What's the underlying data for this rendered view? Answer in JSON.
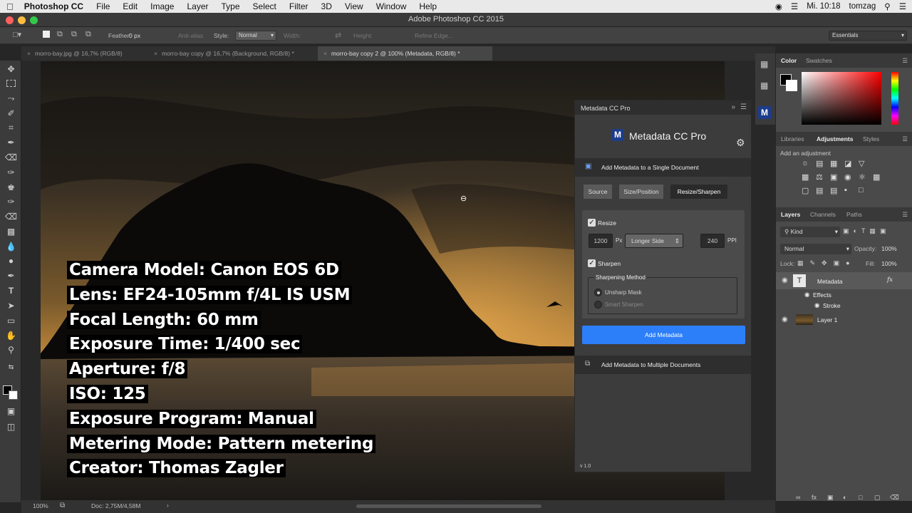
{
  "menubar": {
    "app": "Photoshop CC",
    "items": [
      "File",
      "Edit",
      "Image",
      "Layer",
      "Type",
      "Select",
      "Filter",
      "3D",
      "View",
      "Window",
      "Help"
    ],
    "time": "Mi. 10:18",
    "user": "tomzag"
  },
  "window": {
    "title": "Adobe Photoshop CC 2015"
  },
  "options": {
    "feather_label": "Feather:",
    "feather_value": "0 px",
    "antialias": "Anti-alias",
    "style_label": "Style:",
    "style_value": "Normal",
    "width_label": "Width:",
    "height_label": "Height:",
    "refine_edge": "Refine Edge...",
    "workspace": "Essentials"
  },
  "tabs": [
    "morro-bay.jpg @ 16,7% (RGB/8)",
    "morro-bay copy @ 16,7% (Background, RGB/8) *",
    "morro-bay copy 2 @ 100% (Metadata, RGB/8) *"
  ],
  "exif": [
    "Camera Model: Canon EOS 6D",
    "Lens: EF24-105mm f/4L IS USM",
    "Focal Length: 60 mm",
    "Exposure Time: 1/400 sec",
    "Aperture: f/8",
    "ISO: 125",
    "Exposure Program: Manual",
    "Metering Mode: Pattern metering",
    "Creator: Thomas Zagler"
  ],
  "status": {
    "zoom": "100%",
    "doc": "Doc: 2,75M/4,58M"
  },
  "plugin": {
    "panel_title": "Metadata CC Pro",
    "logo_letter": "M",
    "logo_text": "Metadata CC Pro",
    "single_doc": "Add Metadata to a Single Document",
    "steps": [
      "Source",
      "Size/Position",
      "Resize/Sharpen"
    ],
    "resize_label": "Resize",
    "width_value": "1200",
    "px_unit": "Px",
    "side_option": "Longer Side",
    "ppi_value": "240",
    "ppi_unit": "PPI",
    "sharpen_label": "Sharpen",
    "sharpening_method": "Sharpening Method",
    "method_options": [
      "Unsharp Mask",
      "Smart Sharpen"
    ],
    "add_button": "Add Metadata",
    "multi_doc": "Add Metadata to Multiple Documents",
    "version": "v 1.0"
  },
  "color_panel": {
    "tabs": [
      "Color",
      "Swatches"
    ]
  },
  "adjust_panel": {
    "tabs": [
      "Libraries",
      "Adjustments",
      "Styles"
    ],
    "hint": "Add an adjustment"
  },
  "layers_panel": {
    "tabs": [
      "Layers",
      "Channels",
      "Paths"
    ],
    "filter": "Kind",
    "blend": "Normal",
    "opacity_label": "Opacity:",
    "opacity_value": "100%",
    "lock_label": "Lock:",
    "fill_label": "Fill:",
    "fill_value": "100%",
    "layers": [
      {
        "name": "Metadata",
        "fx": "fx"
      },
      {
        "name": "Effects"
      },
      {
        "name": "Stroke"
      },
      {
        "name": "Layer 1"
      }
    ]
  },
  "colors": {
    "accent_blue": "#2d7ff9",
    "panel_bg": "#4a4a4a",
    "ui_dark": "#282828"
  }
}
